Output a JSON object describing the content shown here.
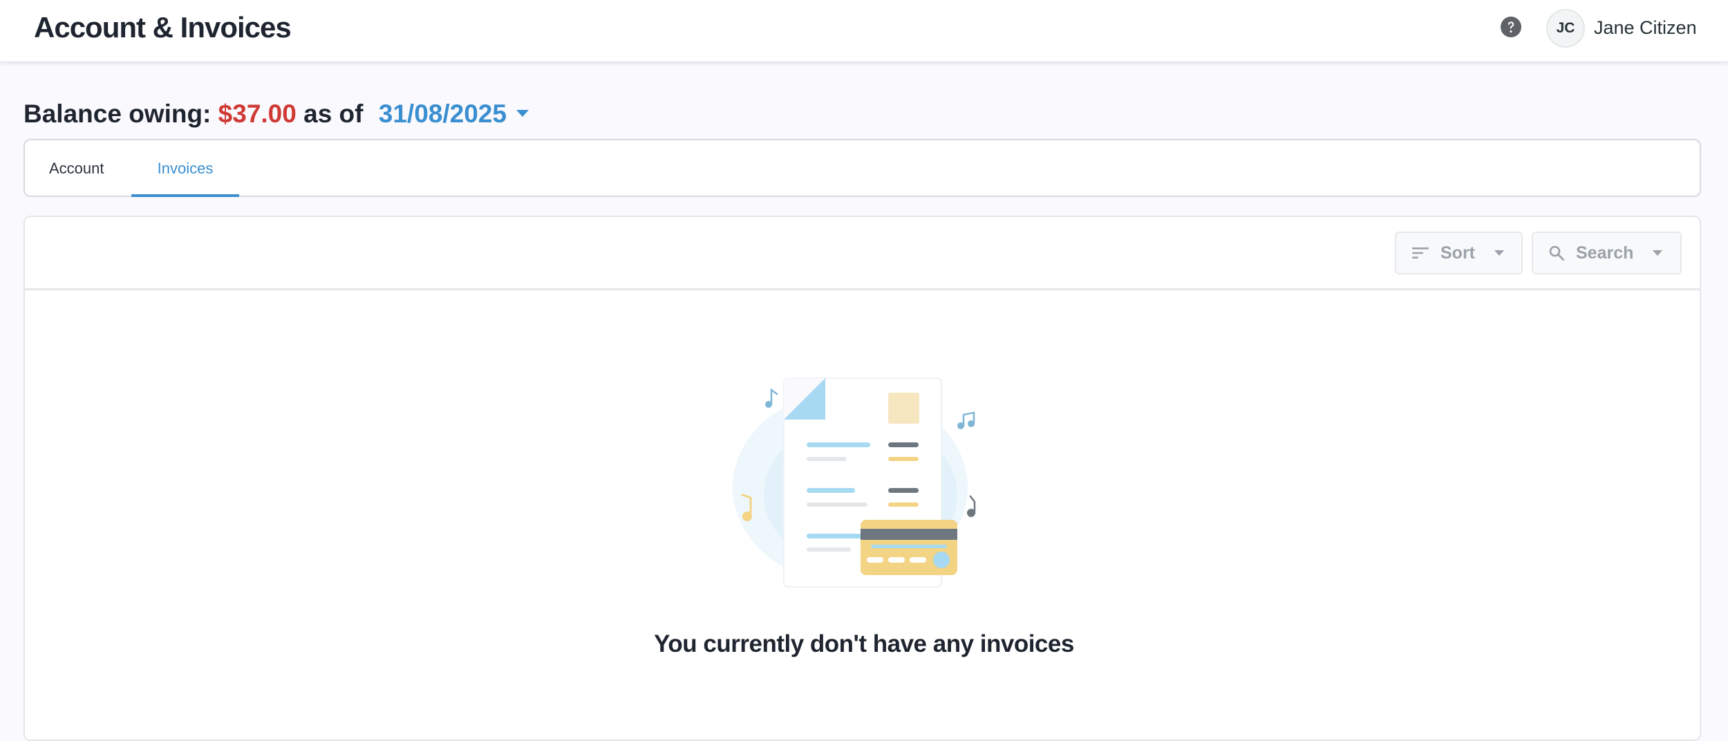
{
  "header": {
    "title": "Account & Invoices",
    "help_icon": "help-circle-icon",
    "user": {
      "initials": "JC",
      "name": "Jane Citizen"
    }
  },
  "balance": {
    "label": "Balance owing:",
    "amount": "$37.00",
    "as_of": "as of",
    "date": "31/08/2025"
  },
  "tabs": [
    {
      "label": "Account",
      "active": false
    },
    {
      "label": "Invoices",
      "active": true
    }
  ],
  "toolbar": {
    "sort_label": "Sort",
    "search_label": "Search",
    "sort_icon": "sort-lines-icon",
    "search_icon": "magnifier-icon"
  },
  "empty_state": {
    "message": "You currently don't have any invoices",
    "illustration": "invoice-document-with-credit-card"
  },
  "colors": {
    "accent": "#3a8fd0",
    "amount_due": "#cf3a35",
    "page_bg": "#faf9fd"
  }
}
